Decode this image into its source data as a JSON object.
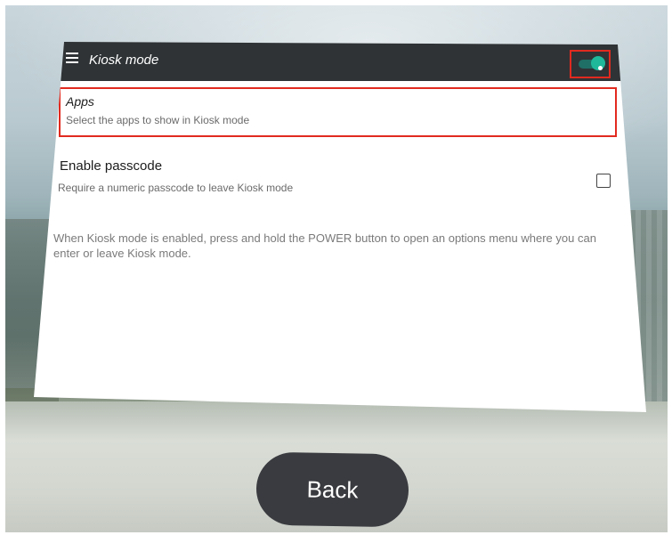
{
  "topbar": {
    "title": "Kiosk mode",
    "menu_icon": "hamburger-menu-icon",
    "kiosk_toggle": {
      "state": "on",
      "accent_color": "#1fb89b"
    }
  },
  "apps_row": {
    "title": "Apps",
    "subtitle": "Select the apps to show in Kiosk mode"
  },
  "passcode_row": {
    "title": "Enable passcode",
    "subtitle": "Require a numeric passcode to leave Kiosk mode",
    "checked": false
  },
  "info": {
    "text": "When Kiosk mode is enabled, press and hold the POWER button to open an options menu where you can enter or leave Kiosk mode."
  },
  "back_button": {
    "label": "Back"
  },
  "colors": {
    "topbar": "#2f3336",
    "highlight": "#e12a1f",
    "button": "#3a3b40"
  }
}
